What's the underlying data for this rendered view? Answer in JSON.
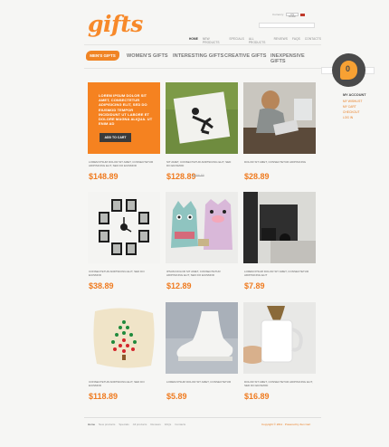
{
  "header": {
    "logo": "gifts",
    "currency_label": "Currency:",
    "currency_value": "US Dollar",
    "top_nav": [
      "HOME",
      "NEW PRODUCTS",
      "SPECIALS",
      "ALL PRODUCTS",
      "REVIEWS",
      "FAQS",
      "CONTACTS"
    ]
  },
  "categories": {
    "active": "MEN'S GIFTS",
    "items": [
      "WOMEN'S GIFTS",
      "INTERESTING GIFTS",
      "CREATIVE GIFTS",
      "INEXPENSIVE GIFTS"
    ]
  },
  "sidebar": {
    "badge_number": "0",
    "account_title": "MY ACCOUNT",
    "links": [
      "MY WISHLIST",
      "MY CART",
      "CHECKOUT",
      "LOG IN"
    ]
  },
  "promo": {
    "text": "LOREM IPSUM DOLOR SIT AMET, CONSECTETUR ADIPISICING ELIT, SED DO EIUSMOD TEMPOR INCIDIDUNT UT LABORE ET DOLORE MAGNA ALIQUA. UT ENIM AD",
    "button": "ADD TO CART",
    "desc": "LOREM IPSUM DOLOR SIT AMET, CONSECTETUR ADIPISICING ELIT, SED DO EIUSMOD",
    "price": "$148.89"
  },
  "products": [
    {
      "desc": "SIT AMET, CONSECTETUR ADIPISICING ELIT, SED DO EIUSMOD",
      "price": "$128.89",
      "old_price": "$156.89"
    },
    {
      "desc": "DOLOR SIT AMET, CONSECTETUR ADIPISICING",
      "price": "$28.89"
    },
    {
      "desc": "CONSECTETUR ADIPISICING ELIT, SED DO EIUSMOD",
      "price": "$38.89"
    },
    {
      "desc": "IPSUM DOLOR SIT AMET, CONSECTETUR ADIPISICING ELIT, SED DO EIUSMOD",
      "price": "$12.89"
    },
    {
      "desc": "LOREM IPSUM DOLOR SIT AMET, CONSECTETUR ADIPISICING ELIT",
      "price": "$7.89"
    },
    {
      "desc": "CONSECTETUR ADIPISICING ELIT, SED DO EIUSMOD",
      "price": "$118.89"
    },
    {
      "desc": "LOREM IPSUM DOLOR SIT AMET, CONSECTETUR",
      "price": "$5.89"
    },
    {
      "desc": "DOLOR SIT AMET, CONSECTETUR ADIPISICING ELIT, SED DO EIUSMOD",
      "price": "$16.89"
    }
  ],
  "footer": {
    "nav": [
      "Home",
      "New products",
      "Specials",
      "All products",
      "Reviews",
      "FAQs",
      "Contacts"
    ],
    "copyright": "Copyright © 2011 · Powered by Zen Cart"
  },
  "colors": {
    "accent": "#f58220",
    "dark": "#3a3a3a",
    "background": "#f6f6f4"
  }
}
